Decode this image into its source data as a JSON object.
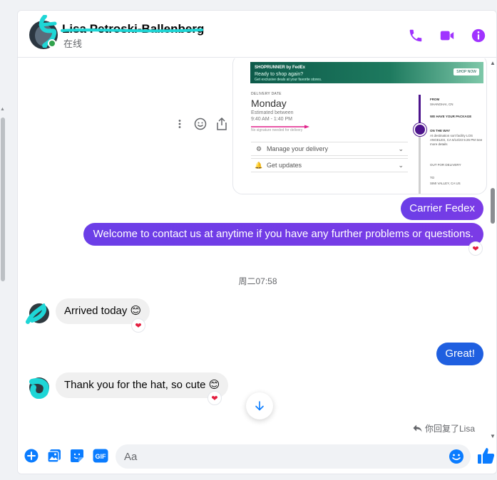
{
  "colors": {
    "accent_purple": "#a033ff",
    "outgoing_purple": "#7b3be6",
    "outgoing_blue": "#1f5fe0",
    "icon_blue": "#0a7cff",
    "online_green": "#31a24c",
    "heart_red": "#e41e3f",
    "scribble_teal": "#1ed6d6"
  },
  "header": {
    "contact_name": "Lisa Petroski-Ballenberg",
    "status": "在线",
    "icons": [
      "phone-icon",
      "video-camera-icon",
      "info-icon"
    ]
  },
  "shared_image": {
    "banner_brand": "SHOPRUNNER by FedEx",
    "banner_title": "Ready to shop again?",
    "banner_subtitle": "Get exclusive deals at your favorite stores.",
    "banner_button": "SHOP NOW",
    "delivery_label": "DELIVERY DATE",
    "delivery_day": "Monday",
    "estimated_label": "Estimated between",
    "estimated_time": "9:40 AM - 1:40 PM",
    "signature_note": "No signature needed for delivery",
    "rows": [
      {
        "icon": "gear-icon",
        "label": "Manage your delivery"
      },
      {
        "icon": "bell-icon",
        "label": "Get updates"
      }
    ],
    "tracking": [
      {
        "title": "FROM",
        "text": "SHANGHAI, CN"
      },
      {
        "title": "WE HAVE YOUR PACKAGE",
        "text": ""
      },
      {
        "title": "ON THE WAY",
        "text": "At destination sort facility LOS ANGELES, CA 6/14/23 5:26 PM See more details"
      },
      {
        "title": "OUT FOR DELIVERY",
        "text": ""
      },
      {
        "title": "TO",
        "text": "SIMI VALLEY, CA US"
      }
    ]
  },
  "message_actions": [
    "more-options-icon",
    "react-emoji-icon",
    "share-icon"
  ],
  "messages": [
    {
      "direction": "out",
      "text": "Carrier Fedex",
      "reaction": ""
    },
    {
      "direction": "out",
      "text": "Welcome to contact us at anytime if you have any further problems or questions.",
      "reaction": "❤"
    },
    {
      "type": "timestamp",
      "text": "周二07:58"
    },
    {
      "direction": "in",
      "text": "Arrived today 😊",
      "reaction": "❤"
    },
    {
      "direction": "out",
      "text": "Great!",
      "reaction": ""
    },
    {
      "direction": "in",
      "text": "Thank you for the hat, so cute 😊",
      "reaction": "❤"
    }
  ],
  "replied_note": "你回复了Lisa",
  "composer": {
    "placeholder": "Aa",
    "buttons": [
      "plus-icon",
      "photo-icon",
      "sticker-icon",
      "gif-icon"
    ],
    "gif_label": "GIF",
    "send_icon": "thumbs-up-icon"
  }
}
